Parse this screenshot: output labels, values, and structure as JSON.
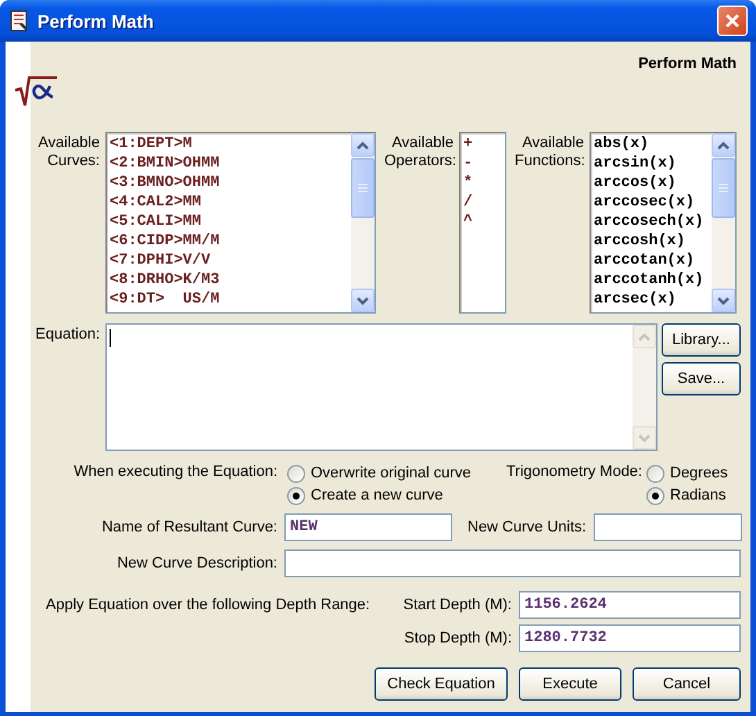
{
  "window": {
    "title": "Perform Math"
  },
  "header": {
    "title": "Perform Math"
  },
  "curves": {
    "label": "Available Curves:",
    "items": [
      "<1:DEPT>M",
      "<2:BMIN>OHMM",
      "<3:BMNO>OHMM",
      "<4:CAL2>MM",
      "<5:CALI>MM",
      "<6:CIDP>MM/M",
      "<7:DPHI>V/V",
      "<8:DRHO>K/M3",
      "<9:DT>  US/M"
    ]
  },
  "operators": {
    "label": "Available Operators:",
    "items": [
      "+",
      "-",
      "*",
      "/",
      "^"
    ]
  },
  "functions": {
    "label": "Available Functions:",
    "items": [
      "abs(x)",
      "arcsin(x)",
      "arccos(x)",
      "arccosec(x)",
      "arccosech(x)",
      "arccosh(x)",
      "arccotan(x)",
      "arccotanh(x)",
      "arcsec(x)"
    ]
  },
  "equation": {
    "label": "Equation:"
  },
  "side_buttons": [
    "Library...",
    "Save..."
  ],
  "execute_mode": {
    "label": "When executing the Equation:",
    "options": [
      {
        "label": "Overwrite original curve",
        "selected": false
      },
      {
        "label": "Create a new curve",
        "selected": true
      }
    ]
  },
  "trig_mode": {
    "label": "Trigonometry Mode:",
    "options": [
      {
        "label": "Degrees",
        "selected": false
      },
      {
        "label": "Radians",
        "selected": true
      }
    ]
  },
  "resultant_name": {
    "label": "Name of Resultant Curve:",
    "value": "NEW"
  },
  "units": {
    "label": "New Curve Units:"
  },
  "description": {
    "label": "New Curve Description:"
  },
  "depth_range": {
    "label": "Apply Equation over the following Depth Range:",
    "start": {
      "label": "Start Depth (M):",
      "value": "1156.2624"
    },
    "stop": {
      "label": "Stop Depth (M):",
      "value": "1280.7732"
    }
  },
  "buttons": [
    "Check Equation",
    "Execute",
    "Cancel"
  ]
}
